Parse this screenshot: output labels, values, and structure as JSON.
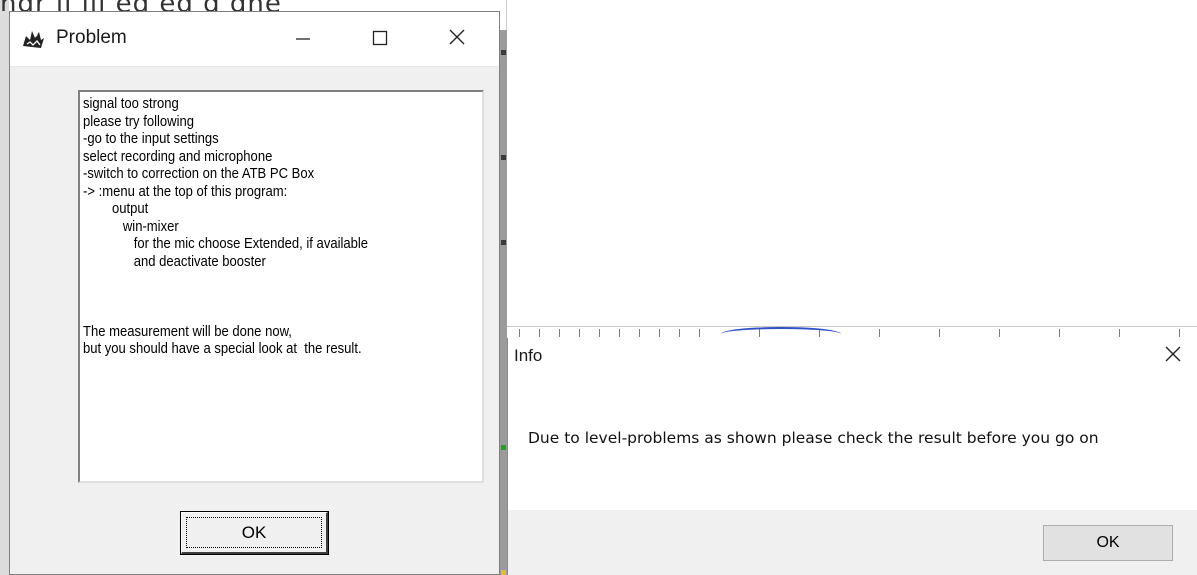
{
  "background": {
    "top_fragment": "ngr  ll  ill  eg  eg       g   ghe"
  },
  "problem_dialog": {
    "title": "Problem",
    "icons": {
      "app": "dragon-icon",
      "minimize": "minimize-icon",
      "maximize": "maximize-icon",
      "close": "close-icon"
    },
    "message_lines": [
      "signal too strong",
      "please try following",
      "-go to the input settings",
      "select recording and microphone",
      "-switch to correction on the ATB PC Box",
      "-> :menu at the top of this program:",
      "        output",
      "           win-mixer",
      "              for the mic choose Extended, if available",
      "              and deactivate booster",
      "",
      "",
      "",
      "The measurement will be done now,",
      "but you should have a special look at  the result."
    ],
    "ok_label": "OK"
  },
  "info_dialog": {
    "title": "Info",
    "close_icon": "close-icon",
    "message": "Due to level-problems as shown please check the result before you go on",
    "ok_label": "OK"
  }
}
